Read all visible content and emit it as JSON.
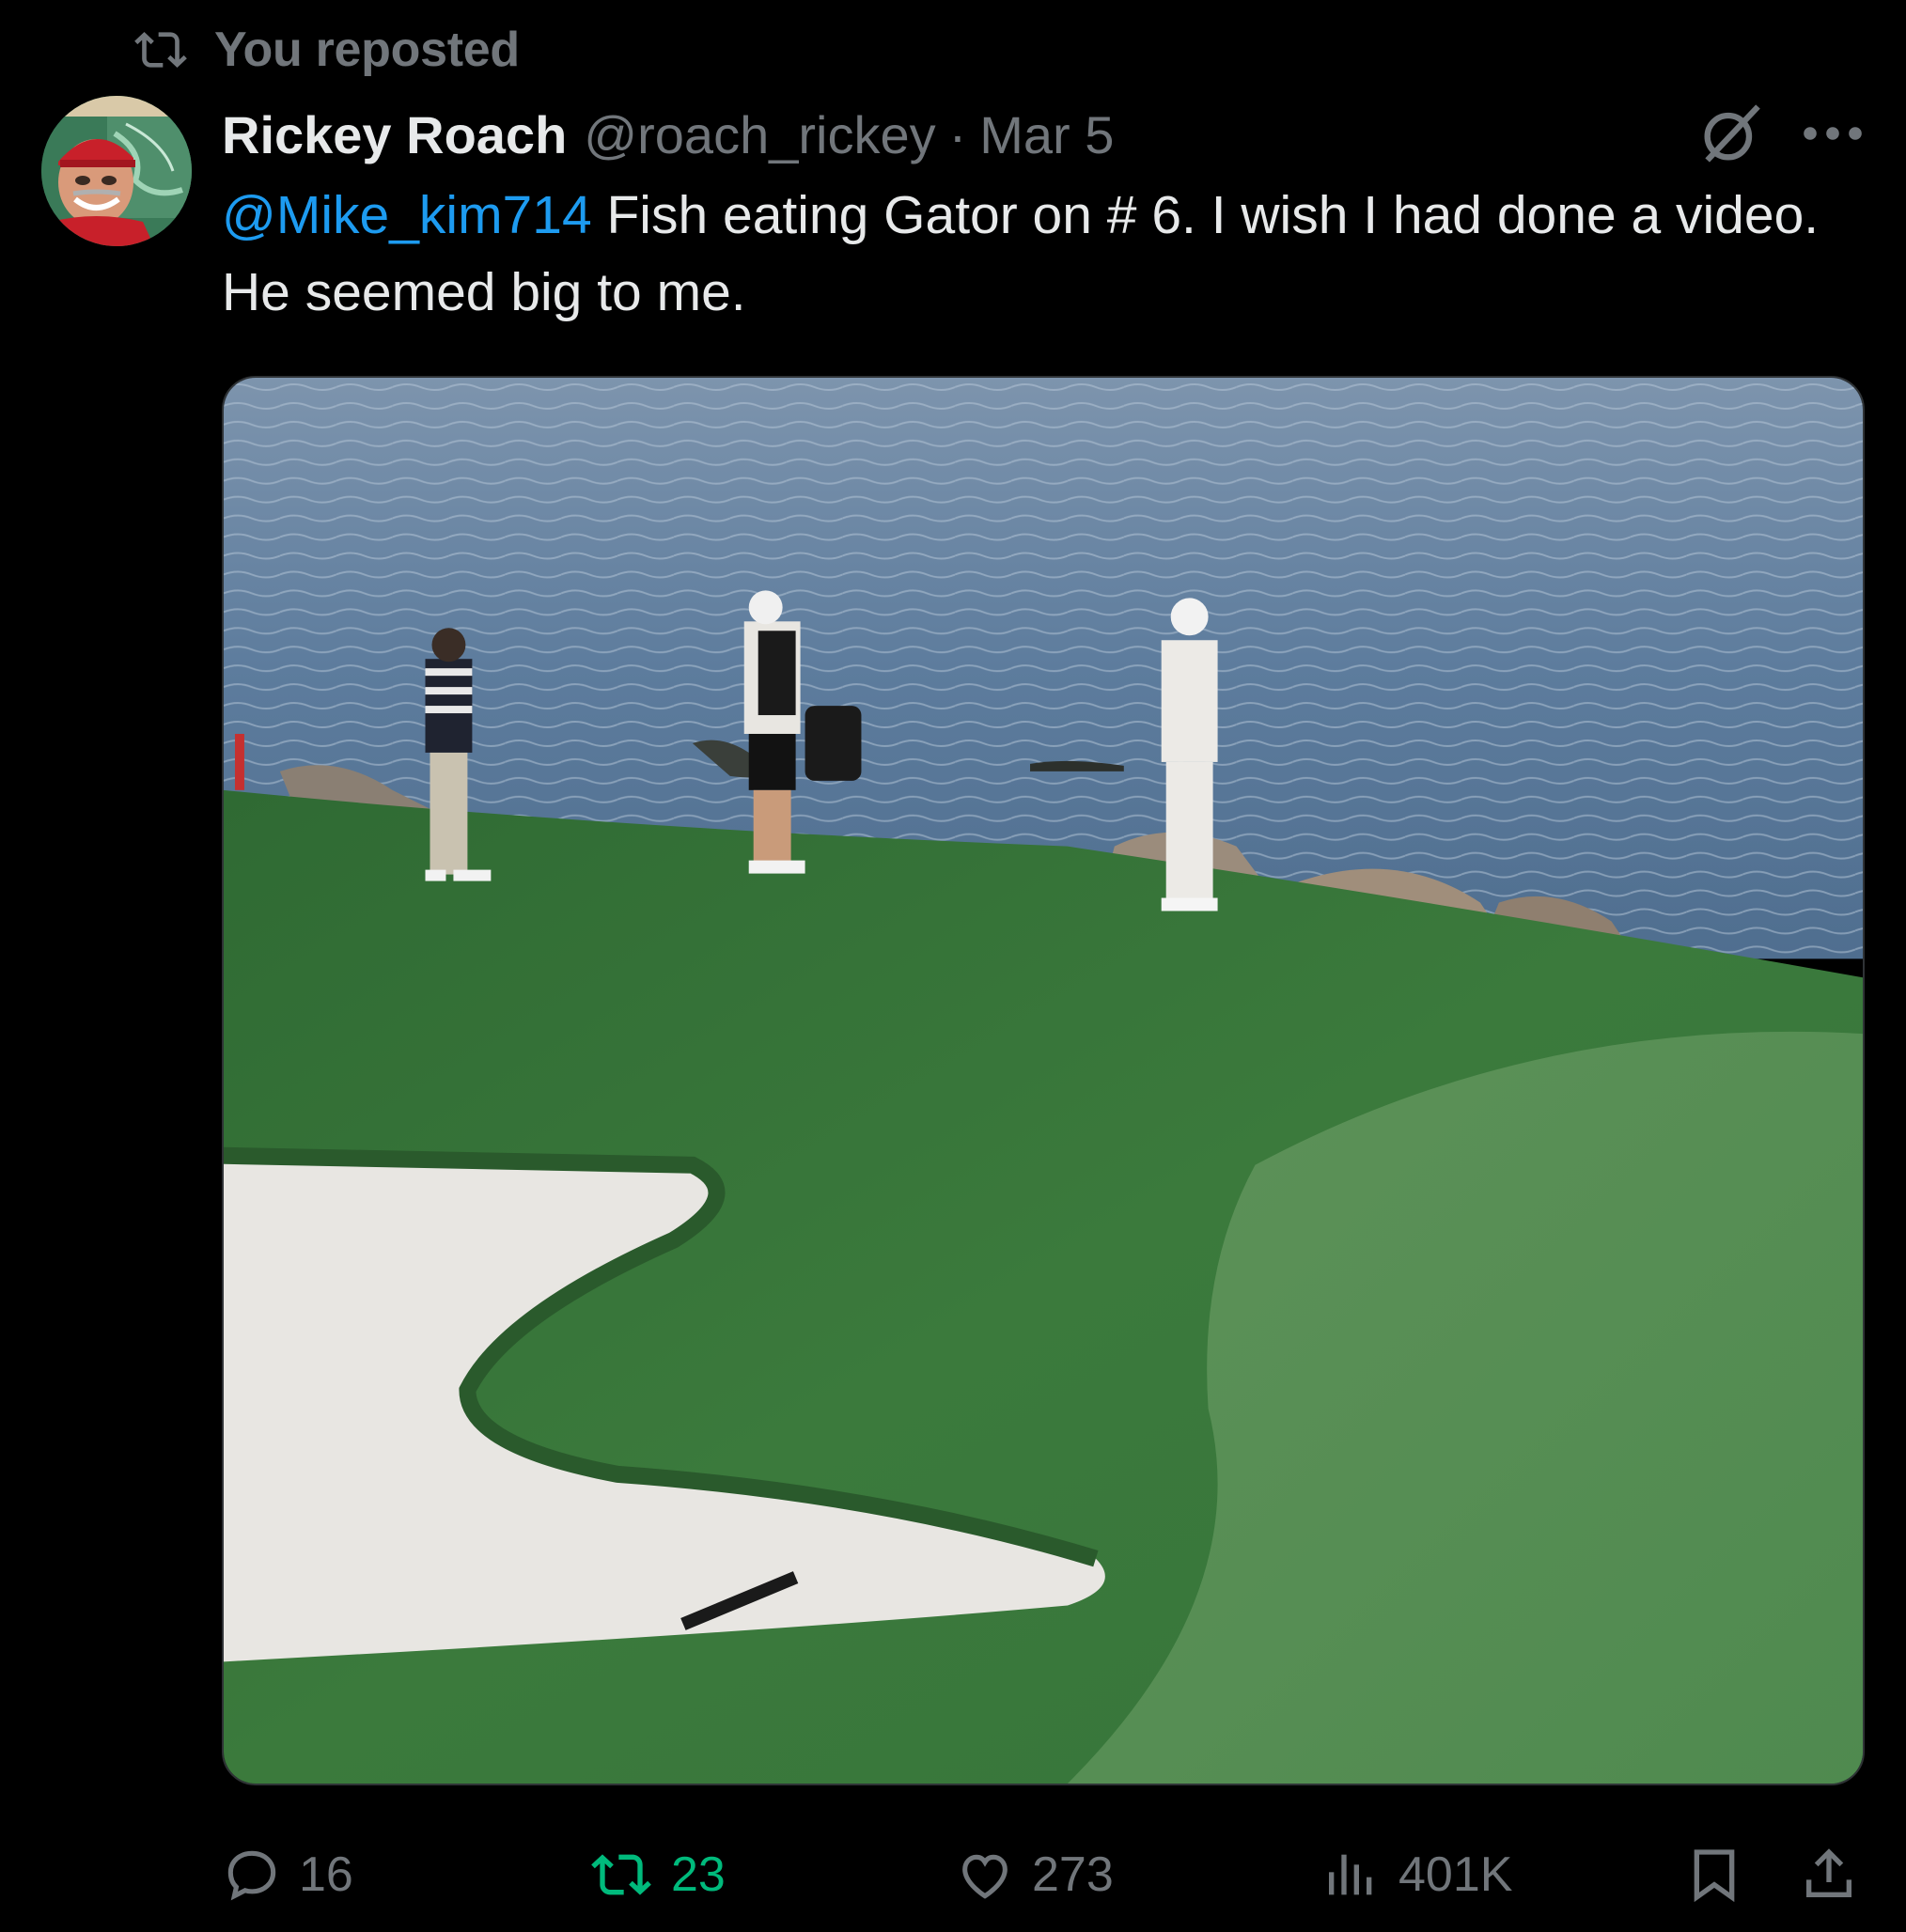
{
  "repost_banner": {
    "icon": "repost-icon",
    "text": "You reposted"
  },
  "tweet": {
    "author_name": "Rickey Roach",
    "author_handle": "@roach_rickey",
    "separator": "·",
    "date": "Mar 5",
    "mention": "@Mike_kim714",
    "body": " Fish eating Gator on # 6.   I wish I had done a video.  He seemed big to me.",
    "media": {
      "type": "photo",
      "icons": [
        "grok-icon",
        "more-icon"
      ]
    }
  },
  "actions": {
    "replies": "16",
    "reposts": "23",
    "likes": "273",
    "views": "401K",
    "bookmark_icon": "bookmark-icon",
    "share_icon": "share-icon"
  },
  "colors": {
    "background": "#000000",
    "text_primary": "#e7e9ea",
    "text_secondary": "#71767b",
    "link": "#1d9bf0",
    "repost_active": "#00ba7c"
  }
}
